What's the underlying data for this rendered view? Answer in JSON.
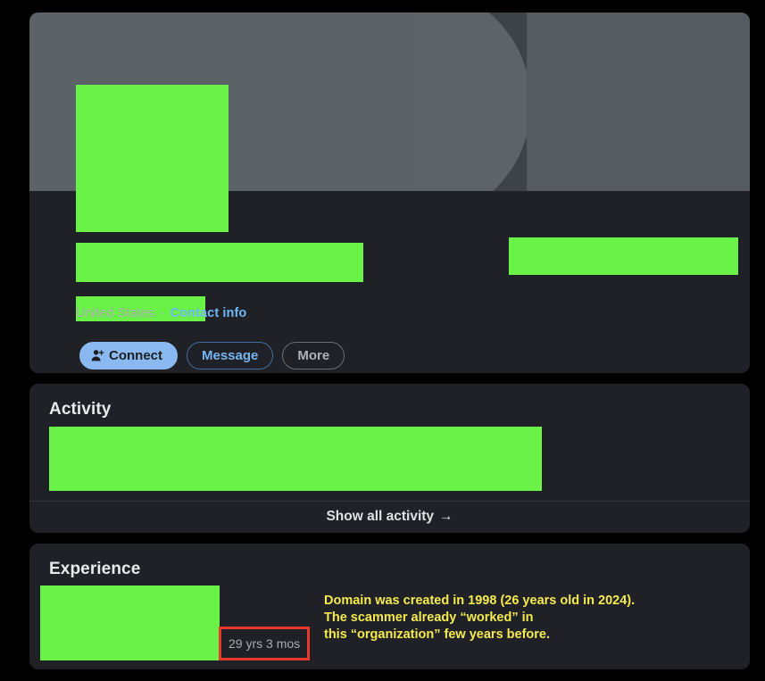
{
  "colors": {
    "page_background": "#000000",
    "card_background": "#1f2126",
    "redaction_green": "#6bf248",
    "annotation_yellow": "#f5ea4e",
    "highlight_red": "#e8392a",
    "link_blue": "#71b7f7",
    "primary_button": "#8ab9f2"
  },
  "profile": {
    "location_text": "United States",
    "separator": "·",
    "contact_info_label": "Contact info",
    "buttons": [
      {
        "label": "Connect",
        "icon": "person-plus-icon",
        "style": "primary"
      },
      {
        "label": "Message",
        "icon": "",
        "style": "outline-blue"
      },
      {
        "label": "More",
        "icon": "",
        "style": "outline-gray"
      }
    ]
  },
  "activity": {
    "title": "Activity",
    "show_all_label": "Show all activity",
    "show_all_arrow": "→"
  },
  "experience": {
    "title": "Experience",
    "duration": "29 yrs 3 mos"
  },
  "annotation": {
    "text": "Domain was created in 1998 (26 years old in 2024).\nThe scammer already “worked” in\nthis “organization” few years before."
  }
}
